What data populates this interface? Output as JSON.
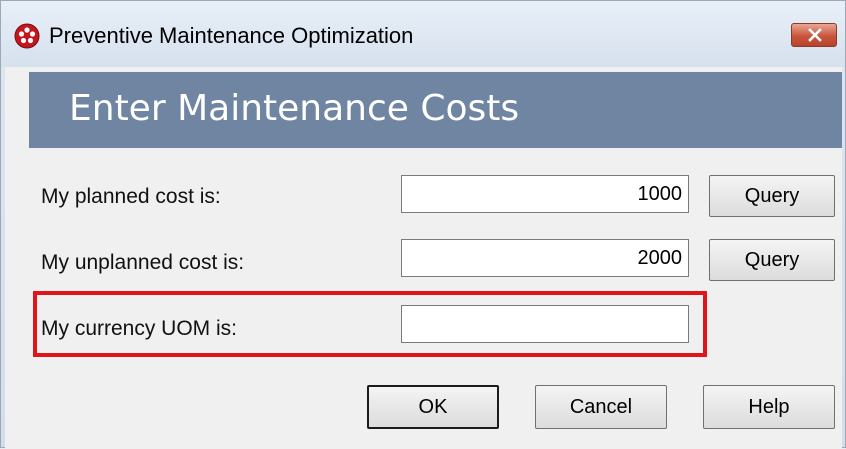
{
  "window": {
    "title": "Preventive Maintenance Optimization",
    "icon": "app-logo-icon",
    "close_icon": "close-icon"
  },
  "banner": {
    "title": "Enter Maintenance Costs"
  },
  "form": {
    "planned": {
      "label": "My planned cost is:",
      "value": "1000",
      "button": "Query"
    },
    "unplanned": {
      "label": "My unplanned cost is:",
      "value": "2000",
      "button": "Query"
    },
    "currency": {
      "label": "My currency UOM is:",
      "value": ""
    }
  },
  "buttons": {
    "ok": "OK",
    "cancel": "Cancel",
    "help": "Help"
  },
  "colors": {
    "banner": "#6f85a1",
    "highlight": "#e0141b",
    "dialog_bg": "#f0f0f0"
  }
}
